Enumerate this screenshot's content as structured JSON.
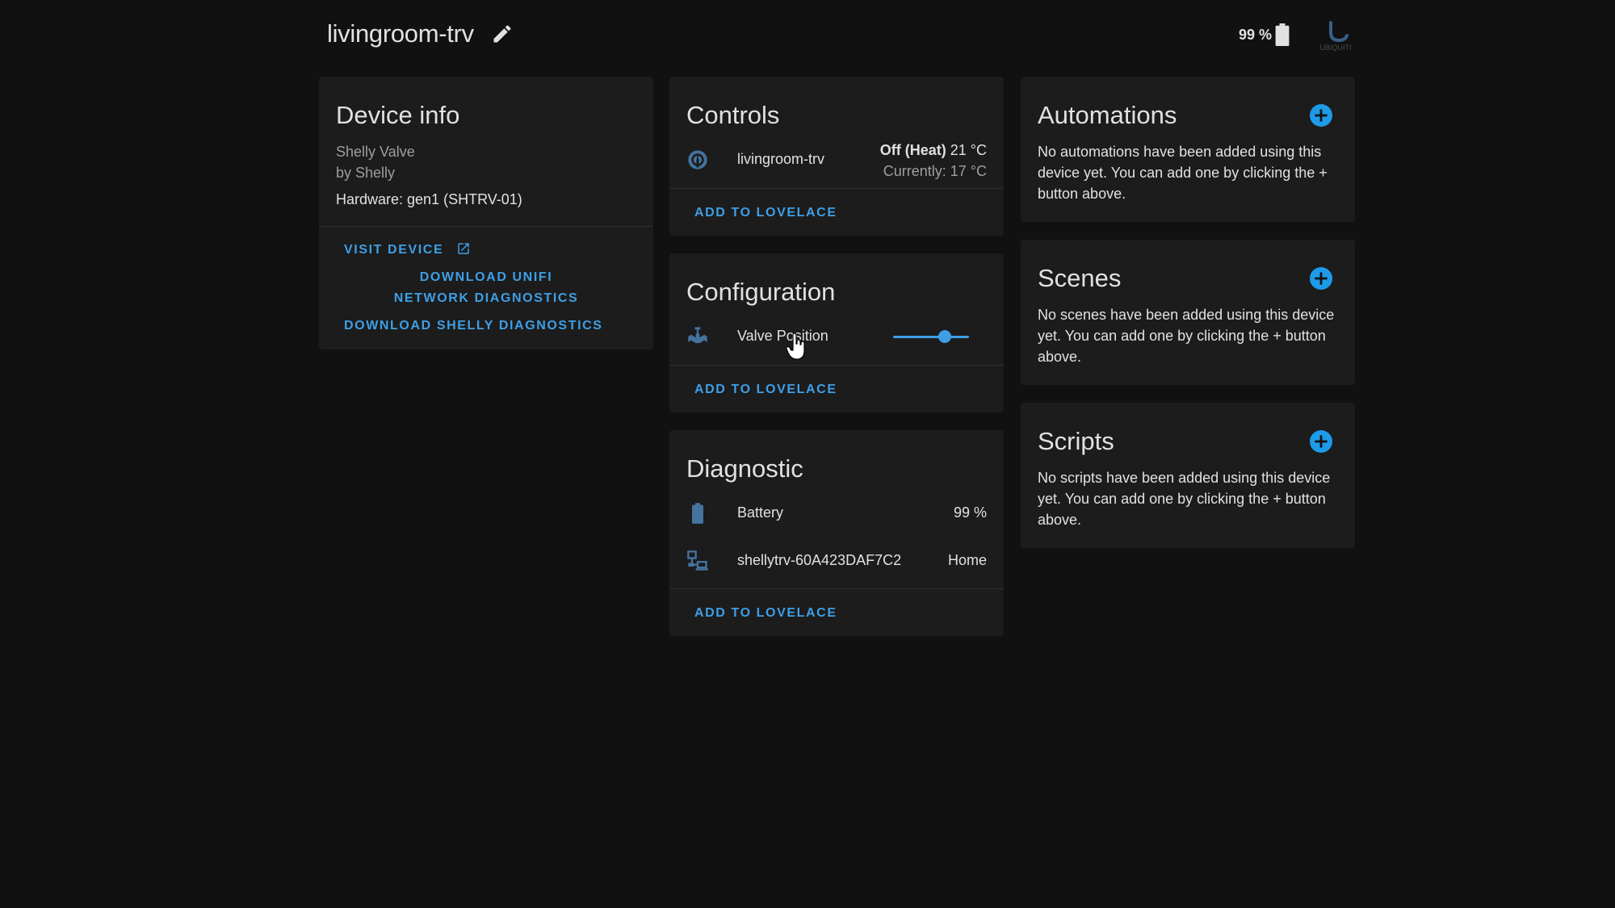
{
  "header": {
    "title": "livingroom-trv",
    "battery": "99 %",
    "icons": {
      "edit": "pencil-icon",
      "battery": "battery-icon",
      "logo": "ubiquiti-logo"
    },
    "logo_text": "UBIQUITI"
  },
  "device_info": {
    "title": "Device info",
    "model": "Shelly Valve",
    "manufacturer": "by Shelly",
    "hardware": "Hardware: gen1 (SHTRV-01)",
    "visit_device": "VISIT DEVICE",
    "download_unifi": "DOWNLOAD UNIFI NETWORK DIAGNOSTICS",
    "download_shelly": "DOWNLOAD SHELLY DIAGNOSTICS"
  },
  "controls": {
    "title": "Controls",
    "entity": {
      "icon": "thermostat-icon",
      "name": "livingroom-trv",
      "mode": "Off (Heat)",
      "target": "21 °C",
      "current": "Currently: 17 °C"
    },
    "add_to_lovelace": "ADD TO LOVELACE"
  },
  "configuration": {
    "title": "Configuration",
    "entity": {
      "icon": "valve-icon",
      "name": "Valve Position",
      "slider_value": 0.68
    },
    "add_to_lovelace": "ADD TO LOVELACE"
  },
  "diagnostic": {
    "title": "Diagnostic",
    "entities": [
      {
        "icon": "battery-icon",
        "name": "Battery",
        "state": "99 %"
      },
      {
        "icon": "lan-icon",
        "name": "shellytrv-60A423DAF7C2",
        "state": "Home"
      }
    ],
    "add_to_lovelace": "ADD TO LOVELACE"
  },
  "automations": {
    "title": "Automations",
    "text": "No automations have been added using this device yet. You can add one by clicking the + button above."
  },
  "scenes": {
    "title": "Scenes",
    "text": "No scenes have been added using this device yet. You can add one by clicking the + button above."
  },
  "scripts": {
    "title": "Scripts",
    "text": "No scripts have been added using this device yet. You can add one by clicking the + button above."
  },
  "colors": {
    "background": "#111111",
    "card": "#1c1c1c",
    "accent": "#3e9fe6",
    "icon": "#44739e",
    "text": "#e1e1e1",
    "secondary_text": "#9e9e9e"
  }
}
